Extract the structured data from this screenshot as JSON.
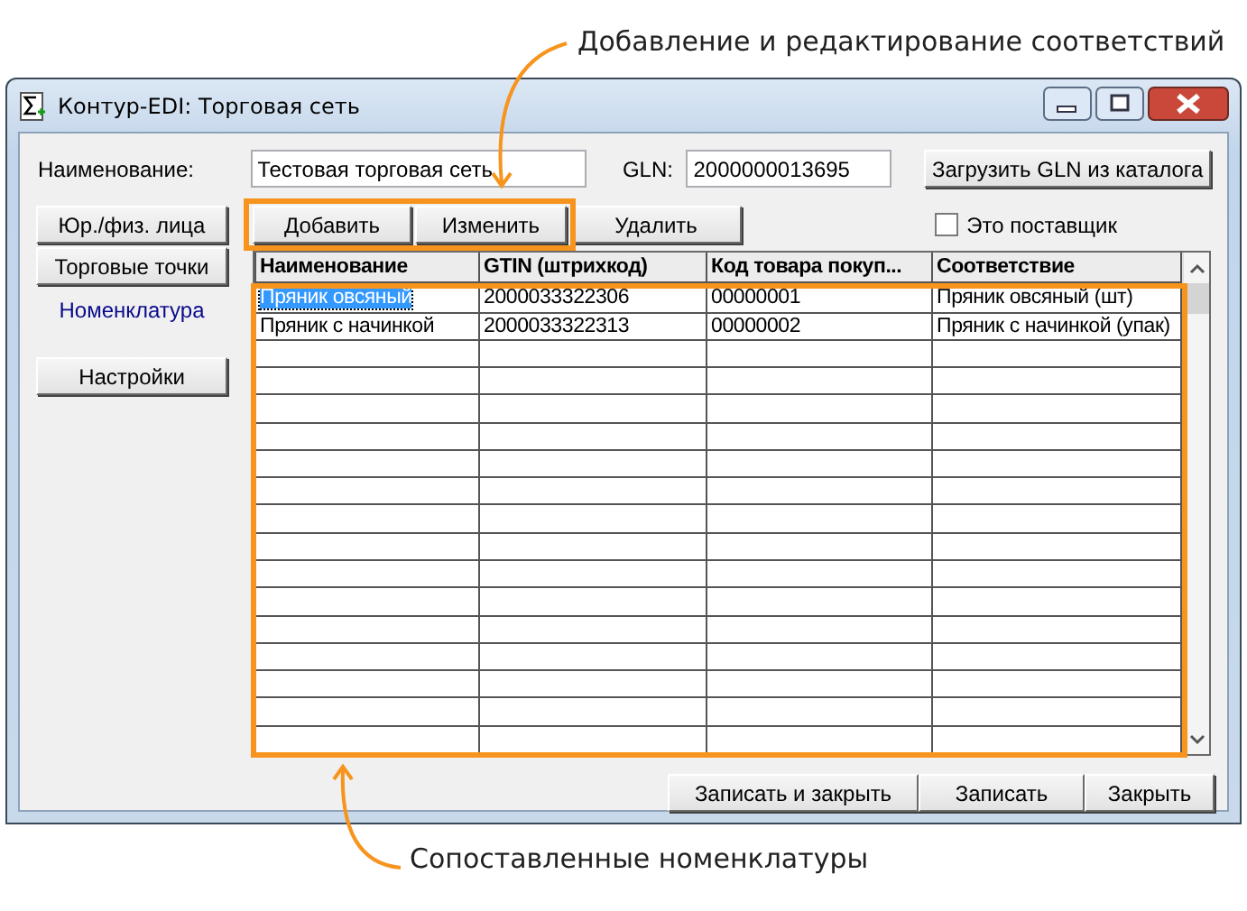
{
  "callouts": {
    "top": "Добавление и редактирование соответствий",
    "bottom": "Сопоставленные номенклатуры"
  },
  "window": {
    "title": "Контур-EDI: Торговая сеть"
  },
  "name_field": {
    "label": "Наименование:",
    "value": "Тестовая торговая сеть"
  },
  "gln_field": {
    "label": "GLN:",
    "value": "2000000013695"
  },
  "load_gln_button": "Загрузить GLN из каталога",
  "nav": [
    {
      "label": "Юр./физ. лица",
      "selected": false
    },
    {
      "label": "Торговые точки",
      "selected": false
    },
    {
      "label": "Номенклатура",
      "selected": true
    }
  ],
  "settings_button": "Настройки",
  "toolbar": [
    "Добавить",
    "Изменить",
    "Удалить"
  ],
  "supplier_checkbox": {
    "label": "Это поставщик",
    "checked": false
  },
  "grid": {
    "columns": [
      "Наименование",
      "GTIN (штрихкод)",
      "Код товара покуп...",
      "Соответствие"
    ],
    "rows": [
      {
        "cells": [
          "Пряник овсяный",
          "2000033322306",
          "00000001",
          "Пряник овсяный (шт)"
        ],
        "selected": true
      },
      {
        "cells": [
          "Пряник с начинкой",
          "2000033322313",
          "00000002",
          "Пряник с начинкой (упак)"
        ],
        "selected": false
      }
    ]
  },
  "footer_buttons": [
    "Записать и закрыть",
    "Записать",
    "Закрыть"
  ]
}
